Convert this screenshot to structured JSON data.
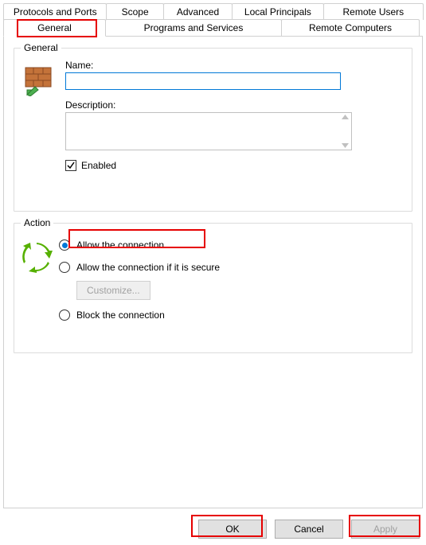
{
  "tabs": {
    "row1": {
      "protocols": "Protocols and Ports",
      "scope": "Scope",
      "advanced": "Advanced",
      "local_principals": "Local Principals",
      "remote_users": "Remote Users"
    },
    "row2": {
      "general": "General",
      "programs": "Programs and Services",
      "remote_computers": "Remote Computers"
    }
  },
  "groups": {
    "general": {
      "title": "General",
      "name_label": "Name:",
      "name_value": "",
      "description_label": "Description:",
      "description_value": "",
      "enabled_label": "Enabled",
      "enabled_checked": true
    },
    "action": {
      "title": "Action",
      "allow": "Allow the connection",
      "allow_secure": "Allow the connection if it is secure",
      "customize": "Customize...",
      "block": "Block the connection",
      "selected": "allow"
    }
  },
  "footer": {
    "ok": "OK",
    "cancel": "Cancel",
    "apply": "Apply"
  }
}
